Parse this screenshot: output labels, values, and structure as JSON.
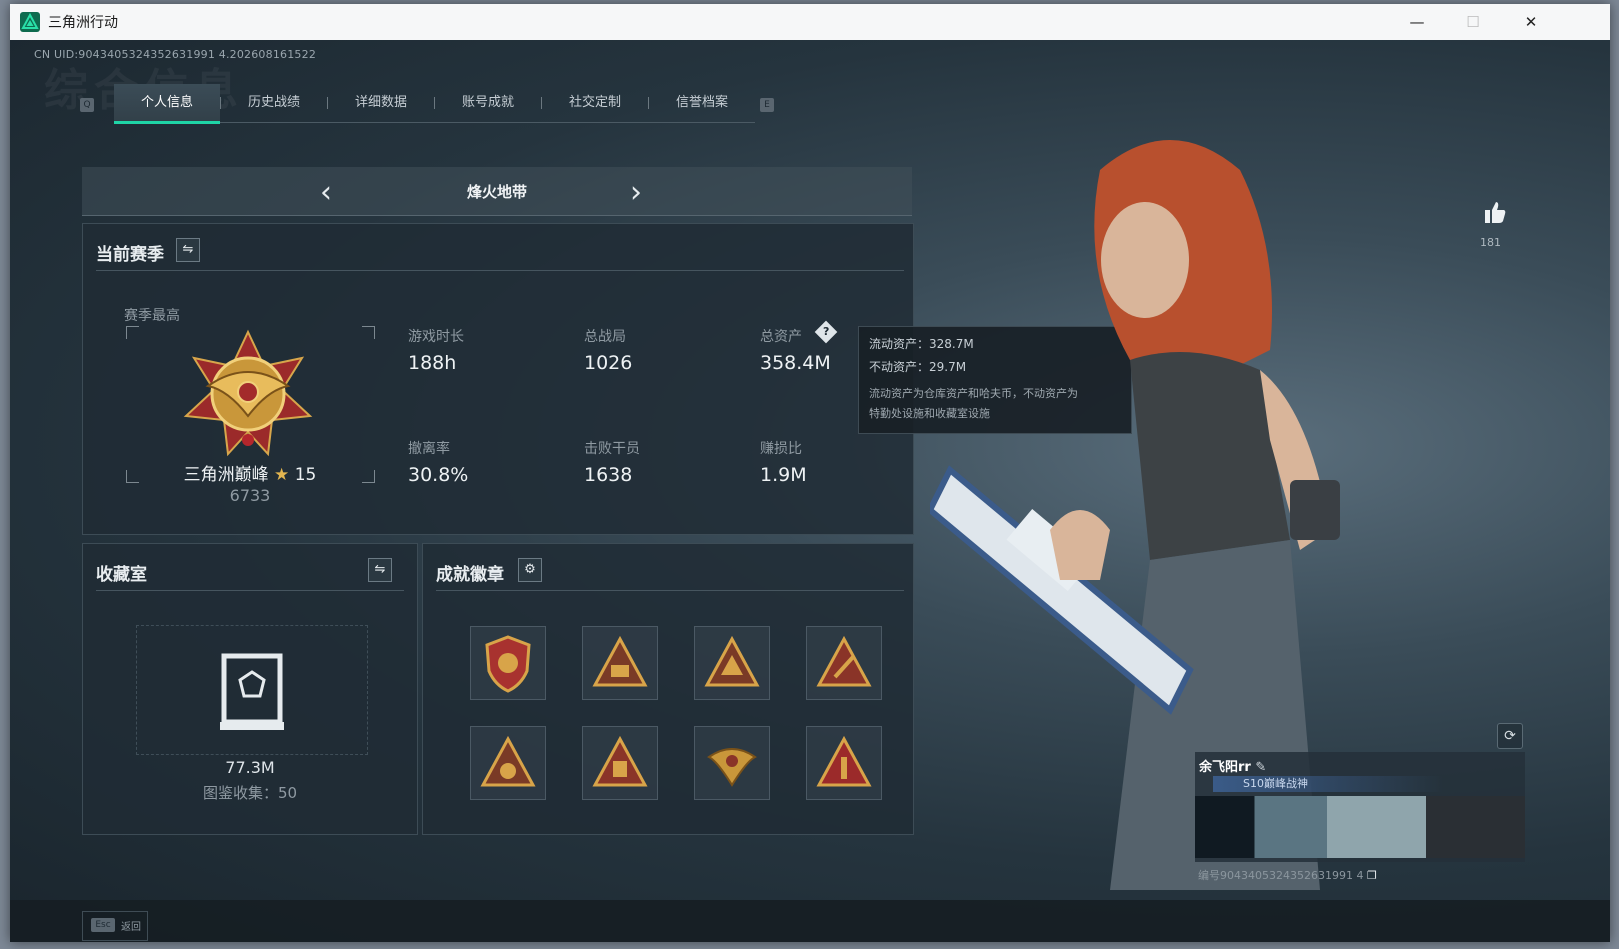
{
  "window": {
    "title": "三角洲行动"
  },
  "header": {
    "uid_text": "CN UID:9043405324352631991 4.202608161522",
    "bg_title": "综合信息"
  },
  "tabs": {
    "left_key": "Q",
    "right_key": "E",
    "items": [
      {
        "label": "个人信息"
      },
      {
        "label": "历史战绩"
      },
      {
        "label": "详细数据"
      },
      {
        "label": "账号成就"
      },
      {
        "label": "社交定制"
      },
      {
        "label": "信誉档案"
      }
    ]
  },
  "mode": {
    "title": "烽火地带"
  },
  "season": {
    "title": "当前赛季",
    "best_label": "赛季最高",
    "rank_name": "三角洲巅峰",
    "rank_stars": "15",
    "rank_score": "6733",
    "stats": [
      {
        "label": "游戏时长",
        "value": "188h"
      },
      {
        "label": "总战局",
        "value": "1026"
      },
      {
        "label": "总资产",
        "value": "358.4M"
      },
      {
        "label": "撤离率",
        "value": "30.8%"
      },
      {
        "label": "击败干员",
        "value": "1638"
      },
      {
        "label": "赚损比",
        "value": "1.9M"
      }
    ]
  },
  "tooltip": {
    "liquid": "流动资产：328.7M",
    "fixed": "不动资产：29.7M",
    "desc1": "流动资产为仓库资产和哈夫币，不动资产为",
    "desc2": "特勤处设施和收藏室设施"
  },
  "collection": {
    "title": "收藏室",
    "value": "77.3M",
    "count_text": "图鉴收集：50"
  },
  "achievements": {
    "title": "成就徽章"
  },
  "profile": {
    "likes": "181",
    "player_name": "余飞阳rr",
    "rank_badge": "S10巅峰战神",
    "uid": "编号9043405324352631991 4"
  },
  "footer": {
    "esc_key": "Esc",
    "back_label": "返回"
  },
  "colors": {
    "accent": "#1fd4a6",
    "tab_active_bg": "#3b4c57",
    "gold": "#c9973a"
  }
}
